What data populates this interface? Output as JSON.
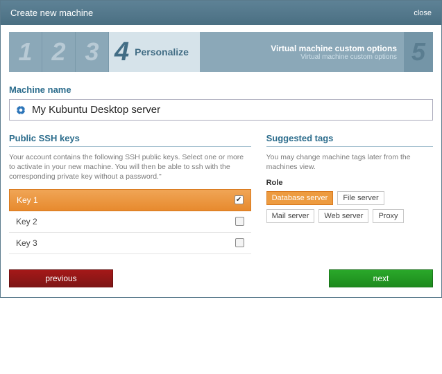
{
  "titlebar": {
    "title": "Create new machine",
    "close": "close"
  },
  "steps": {
    "s1": "1",
    "s2": "2",
    "s3": "3",
    "current_num": "4",
    "current_label": "Personalize",
    "opts_line1": "Virtual machine custom options",
    "opts_line2": "Virtual machine custom options",
    "s5": "5"
  },
  "name": {
    "label": "Machine name",
    "value": "My Kubuntu Desktop server"
  },
  "ssh": {
    "heading": "Public SSH keys",
    "hint": "Your account contains the following SSH public keys. Select one or more to activate in your new machine. You will then be able to ssh with the corresponding private key without a password.\"",
    "keys": [
      {
        "label": "Key 1",
        "selected": true
      },
      {
        "label": "Key 2",
        "selected": false
      },
      {
        "label": "Key 3",
        "selected": false
      }
    ]
  },
  "tags": {
    "heading": "Suggested tags",
    "hint": "You may change machine tags later from the machines view.",
    "role_label": "Role",
    "items": [
      {
        "label": "Database server",
        "selected": true
      },
      {
        "label": "File server",
        "selected": false
      },
      {
        "label": "Mail server",
        "selected": false
      },
      {
        "label": "Web server",
        "selected": false
      },
      {
        "label": "Proxy",
        "selected": false
      }
    ]
  },
  "footer": {
    "prev": "previous",
    "next": "next"
  }
}
